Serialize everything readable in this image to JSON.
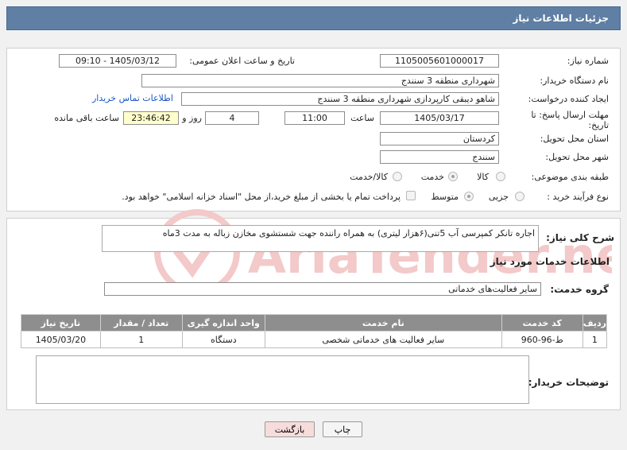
{
  "header": {
    "title": "جزئیات اطلاعات نیاز"
  },
  "form": {
    "need_number_label": "شماره نیاز:",
    "need_number": "1105005601000017",
    "announce_label": "تاریخ و ساعت اعلان عمومی:",
    "announce_value": "1405/03/12 - 09:10",
    "buyer_org_label": "نام دستگاه خریدار:",
    "buyer_org": "شهرداری منطقه 3 سنندج",
    "creator_label": "ایجاد کننده درخواست:",
    "creator": "شاهو دیبقی کارپردازی شهرداری منطقه 3 سنندج",
    "contact_link": "اطلاعات تماس خریدار",
    "deadline_label": "مهلت ارسال پاسخ: تا تاریخ:",
    "deadline_date": "1405/03/17",
    "time_label": "ساعت",
    "deadline_time": "11:00",
    "days_value": "4",
    "days_label": "روز و",
    "remaining_value": "23:46:42",
    "remaining_label": "ساعت باقی مانده",
    "province_label": "استان محل تحویل:",
    "province": "کردستان",
    "city_label": "شهر محل تحویل:",
    "city": "سنندج",
    "category_label": "طبقه بندی موضوعی:",
    "category_options": [
      "کالا",
      "خدمت",
      "کالا/خدمت"
    ],
    "process_label": "نوع فرآیند خرید :",
    "process_options": [
      "جزیی",
      "متوسط"
    ],
    "payment_note": "پرداخت تمام یا بخشی از مبلغ خرید،از محل \"اسناد خزانه اسلامی\" خواهد بود."
  },
  "details": {
    "description_label": "شرح کلی نیاز:",
    "description": "اجاره تانکر کمپرسی آب  5تنی(۶هزار لیتری) به همراه راننده  جهت شستشوی مخازن زباله به مدت 3ماه",
    "services_heading": "اطلاعات خدمات مورد نیاز",
    "service_group_label": "گروه خدمت:",
    "service_group": "سایر فعالیت‌های خدماتی",
    "table": {
      "headers": [
        "ردیف",
        "کد خدمت",
        "نام خدمت",
        "واحد اندازه گیری",
        "تعداد / مقدار",
        "تاریخ نیاز"
      ],
      "rows": [
        [
          "1",
          "ط-96-960",
          "سایر فعالیت های خدماتی شخصی",
          "دستگاه",
          "1",
          "1405/03/20"
        ]
      ]
    },
    "buyer_notes_label": "توضیحات خریدار:",
    "buyer_notes": ""
  },
  "buttons": {
    "print": "چاپ",
    "back": "بازگشت"
  },
  "watermark": {
    "text": "AriaTender.net"
  },
  "colors": {
    "header_bg": "#5f7fa4",
    "highlight": "#ffffcc",
    "back_button": "#f7dcdc",
    "watermark": "#f3c9c9"
  }
}
